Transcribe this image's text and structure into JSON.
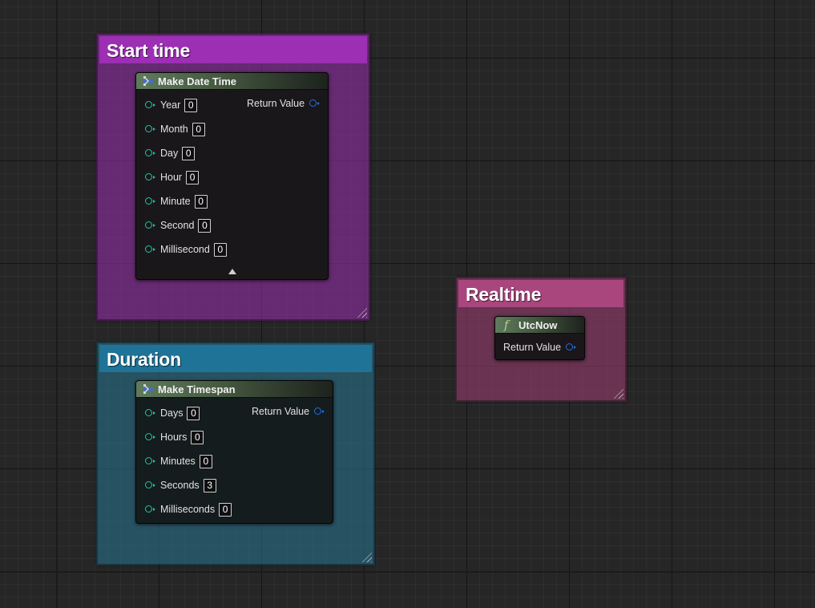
{
  "comments": {
    "start_time": {
      "title": "Start time",
      "color": "#9c2fb3"
    },
    "duration": {
      "title": "Duration",
      "color": "#1f7396"
    },
    "realtime": {
      "title": "Realtime",
      "color": "#a8467d"
    }
  },
  "nodes": {
    "make_date_time": {
      "title": "Make Date Time",
      "icon": "struct-make-icon",
      "return_label": "Return Value",
      "pins": [
        {
          "label": "Year",
          "value": "0"
        },
        {
          "label": "Month",
          "value": "0"
        },
        {
          "label": "Day",
          "value": "0"
        },
        {
          "label": "Hour",
          "value": "0"
        },
        {
          "label": "Minute",
          "value": "0"
        },
        {
          "label": "Second",
          "value": "0"
        },
        {
          "label": "Millisecond",
          "value": "0"
        }
      ],
      "expand_icon": "triangle-up-icon"
    },
    "make_timespan": {
      "title": "Make Timespan",
      "icon": "struct-make-icon",
      "return_label": "Return Value",
      "pins": [
        {
          "label": "Days",
          "value": "0"
        },
        {
          "label": "Hours",
          "value": "0"
        },
        {
          "label": "Minutes",
          "value": "0"
        },
        {
          "label": "Seconds",
          "value": "3"
        },
        {
          "label": "Milliseconds",
          "value": "0"
        }
      ]
    },
    "utc_now": {
      "title": "UtcNow",
      "icon_glyph": "f",
      "return_label": "Return Value"
    }
  },
  "colors": {
    "input_pin": "#19c8a0",
    "output_pin": "#1f6fe0",
    "node_header": "#5f7b5d",
    "graph_background": "#262626"
  }
}
